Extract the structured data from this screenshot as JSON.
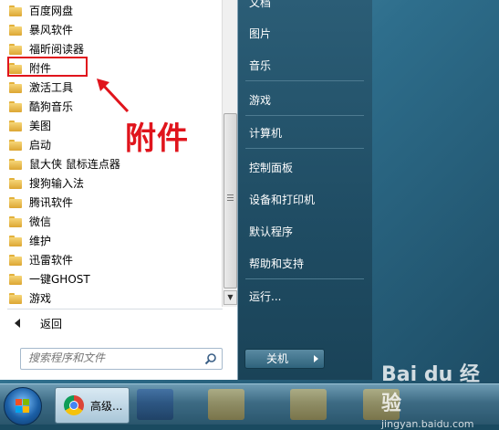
{
  "programs": [
    {
      "label": "百度网盘"
    },
    {
      "label": "暴风软件"
    },
    {
      "label": "福昕阅读器"
    },
    {
      "label": "附件"
    },
    {
      "label": "激活工具"
    },
    {
      "label": "酷狗音乐"
    },
    {
      "label": "美图"
    },
    {
      "label": "启动"
    },
    {
      "label": "鼠大侠 鼠标连点器"
    },
    {
      "label": "搜狗输入法"
    },
    {
      "label": "腾讯软件"
    },
    {
      "label": "微信"
    },
    {
      "label": "维护"
    },
    {
      "label": "迅雷软件"
    },
    {
      "label": "一键GHOST"
    },
    {
      "label": "游戏"
    }
  ],
  "back_label": "返回",
  "search": {
    "placeholder": "搜索程序和文件"
  },
  "annotation": {
    "label": "附件",
    "color": "#e0141c"
  },
  "right_menu": {
    "documents": "文档",
    "pictures": "图片",
    "music": "音乐",
    "games": "游戏",
    "computer": "计算机",
    "control_panel": "控制面板",
    "devices": "设备和打印机",
    "defaults": "默认程序",
    "help": "帮助和支持",
    "run": "运行..."
  },
  "shutdown_label": "关机",
  "taskbar": {
    "chrome_label": "高级..."
  },
  "watermark": {
    "logo": "Bai du 经验",
    "sub": "jingyan.baidu.com"
  }
}
